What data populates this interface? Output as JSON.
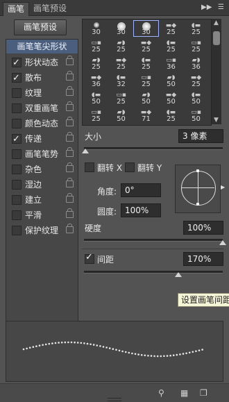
{
  "tabs": {
    "brush": "画笔",
    "brush_presets": "画笔预设"
  },
  "header_icons": {
    "collapse": "collapse-icon",
    "menu": "panel-menu-icon"
  },
  "preset_button": "画笔预设",
  "options_header": "画笔笔尖形状",
  "options": [
    {
      "label": "形状动态",
      "checked": true
    },
    {
      "label": "散布",
      "checked": true
    },
    {
      "label": "纹理",
      "checked": false
    },
    {
      "label": "双重画笔",
      "checked": false
    },
    {
      "label": "颜色动态",
      "checked": false
    },
    {
      "label": "传递",
      "checked": true
    },
    {
      "label": "画笔笔势",
      "checked": false
    },
    {
      "label": "杂色",
      "checked": false
    },
    {
      "label": "湿边",
      "checked": false
    },
    {
      "label": "建立",
      "checked": false
    },
    {
      "label": "平滑",
      "checked": false
    },
    {
      "label": "保护纹理",
      "checked": false
    }
  ],
  "brush_grid": {
    "rows": [
      [
        "30",
        "30",
        "30",
        "25",
        "25"
      ],
      [
        "25",
        "25",
        "25",
        "25",
        "25"
      ],
      [
        "25",
        "25",
        "25",
        "36",
        "36"
      ],
      [
        "36",
        "32",
        "25",
        "50",
        "25"
      ],
      [
        "50",
        "25",
        "50",
        "50",
        "50"
      ],
      [
        "25",
        "50",
        "71",
        "25",
        "50"
      ]
    ],
    "selected": [
      0,
      2
    ]
  },
  "size": {
    "label": "大小",
    "value": "3 像素",
    "level": 0.01
  },
  "flip_x": "翻转 X",
  "flip_y": "翻转 Y",
  "angle": {
    "label": "角度:",
    "value": "0°"
  },
  "roundness": {
    "label": "圆度:",
    "value": "100%"
  },
  "hardness": {
    "label": "硬度",
    "value": "100%",
    "level": 1.0
  },
  "spacing": {
    "label": "间距",
    "checked": true,
    "value": "170%",
    "level": 0.68
  },
  "tooltip": "设置画笔间距",
  "footer_icons": [
    "toggle-brush-icon",
    "grid-icon",
    "new-brush-icon"
  ]
}
